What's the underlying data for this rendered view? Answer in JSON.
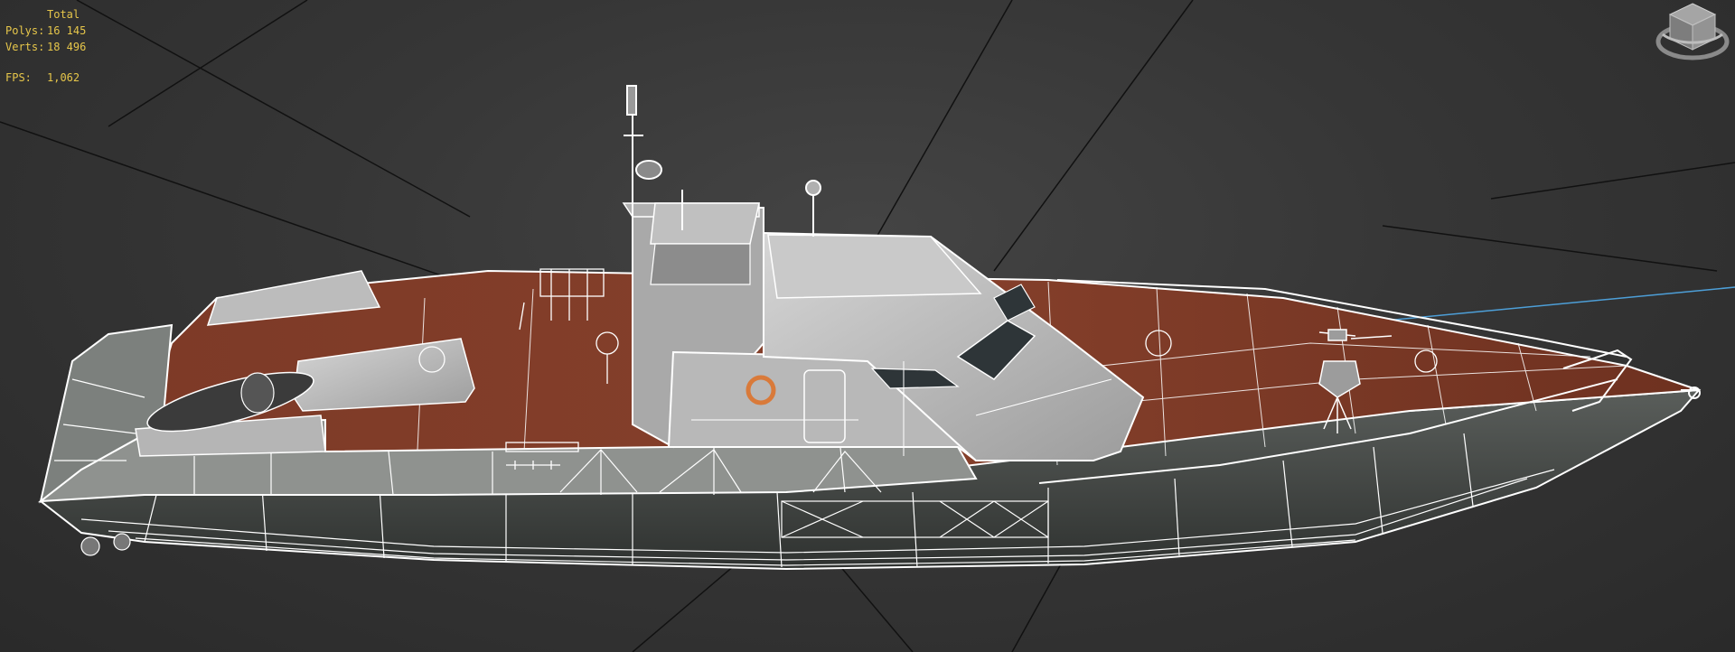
{
  "viewport": {
    "stats": {
      "header": "Total",
      "polys_label": "Polys:",
      "polys_value": "16 145",
      "verts_label": "Verts:",
      "verts_value": "18 496",
      "fps_label": "FPS:",
      "fps_value": "1,062"
    },
    "colors": {
      "background": "#3a3a3a",
      "stats_text": "#e6c64a",
      "wireframe": "#ffffff",
      "deck": "#7a3522",
      "hull": "#3e423f",
      "superstructure": "#c8c8c8",
      "selection_line": "#4d9fd8"
    },
    "icons": {
      "viewcube": "viewcube-icon"
    }
  }
}
